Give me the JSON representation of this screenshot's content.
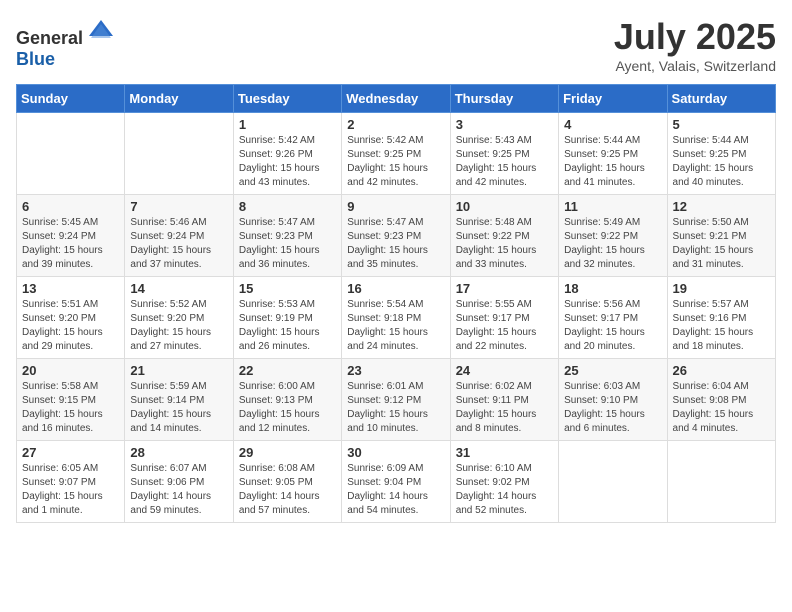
{
  "header": {
    "logo_general": "General",
    "logo_blue": "Blue",
    "title": "July 2025",
    "subtitle": "Ayent, Valais, Switzerland"
  },
  "calendar": {
    "days_of_week": [
      "Sunday",
      "Monday",
      "Tuesday",
      "Wednesday",
      "Thursday",
      "Friday",
      "Saturday"
    ],
    "weeks": [
      [
        {
          "day": null,
          "info": null
        },
        {
          "day": null,
          "info": null
        },
        {
          "day": "1",
          "info": "Sunrise: 5:42 AM\nSunset: 9:26 PM\nDaylight: 15 hours and 43 minutes."
        },
        {
          "day": "2",
          "info": "Sunrise: 5:42 AM\nSunset: 9:25 PM\nDaylight: 15 hours and 42 minutes."
        },
        {
          "day": "3",
          "info": "Sunrise: 5:43 AM\nSunset: 9:25 PM\nDaylight: 15 hours and 42 minutes."
        },
        {
          "day": "4",
          "info": "Sunrise: 5:44 AM\nSunset: 9:25 PM\nDaylight: 15 hours and 41 minutes."
        },
        {
          "day": "5",
          "info": "Sunrise: 5:44 AM\nSunset: 9:25 PM\nDaylight: 15 hours and 40 minutes."
        }
      ],
      [
        {
          "day": "6",
          "info": "Sunrise: 5:45 AM\nSunset: 9:24 PM\nDaylight: 15 hours and 39 minutes."
        },
        {
          "day": "7",
          "info": "Sunrise: 5:46 AM\nSunset: 9:24 PM\nDaylight: 15 hours and 37 minutes."
        },
        {
          "day": "8",
          "info": "Sunrise: 5:47 AM\nSunset: 9:23 PM\nDaylight: 15 hours and 36 minutes."
        },
        {
          "day": "9",
          "info": "Sunrise: 5:47 AM\nSunset: 9:23 PM\nDaylight: 15 hours and 35 minutes."
        },
        {
          "day": "10",
          "info": "Sunrise: 5:48 AM\nSunset: 9:22 PM\nDaylight: 15 hours and 33 minutes."
        },
        {
          "day": "11",
          "info": "Sunrise: 5:49 AM\nSunset: 9:22 PM\nDaylight: 15 hours and 32 minutes."
        },
        {
          "day": "12",
          "info": "Sunrise: 5:50 AM\nSunset: 9:21 PM\nDaylight: 15 hours and 31 minutes."
        }
      ],
      [
        {
          "day": "13",
          "info": "Sunrise: 5:51 AM\nSunset: 9:20 PM\nDaylight: 15 hours and 29 minutes."
        },
        {
          "day": "14",
          "info": "Sunrise: 5:52 AM\nSunset: 9:20 PM\nDaylight: 15 hours and 27 minutes."
        },
        {
          "day": "15",
          "info": "Sunrise: 5:53 AM\nSunset: 9:19 PM\nDaylight: 15 hours and 26 minutes."
        },
        {
          "day": "16",
          "info": "Sunrise: 5:54 AM\nSunset: 9:18 PM\nDaylight: 15 hours and 24 minutes."
        },
        {
          "day": "17",
          "info": "Sunrise: 5:55 AM\nSunset: 9:17 PM\nDaylight: 15 hours and 22 minutes."
        },
        {
          "day": "18",
          "info": "Sunrise: 5:56 AM\nSunset: 9:17 PM\nDaylight: 15 hours and 20 minutes."
        },
        {
          "day": "19",
          "info": "Sunrise: 5:57 AM\nSunset: 9:16 PM\nDaylight: 15 hours and 18 minutes."
        }
      ],
      [
        {
          "day": "20",
          "info": "Sunrise: 5:58 AM\nSunset: 9:15 PM\nDaylight: 15 hours and 16 minutes."
        },
        {
          "day": "21",
          "info": "Sunrise: 5:59 AM\nSunset: 9:14 PM\nDaylight: 15 hours and 14 minutes."
        },
        {
          "day": "22",
          "info": "Sunrise: 6:00 AM\nSunset: 9:13 PM\nDaylight: 15 hours and 12 minutes."
        },
        {
          "day": "23",
          "info": "Sunrise: 6:01 AM\nSunset: 9:12 PM\nDaylight: 15 hours and 10 minutes."
        },
        {
          "day": "24",
          "info": "Sunrise: 6:02 AM\nSunset: 9:11 PM\nDaylight: 15 hours and 8 minutes."
        },
        {
          "day": "25",
          "info": "Sunrise: 6:03 AM\nSunset: 9:10 PM\nDaylight: 15 hours and 6 minutes."
        },
        {
          "day": "26",
          "info": "Sunrise: 6:04 AM\nSunset: 9:08 PM\nDaylight: 15 hours and 4 minutes."
        }
      ],
      [
        {
          "day": "27",
          "info": "Sunrise: 6:05 AM\nSunset: 9:07 PM\nDaylight: 15 hours and 1 minute."
        },
        {
          "day": "28",
          "info": "Sunrise: 6:07 AM\nSunset: 9:06 PM\nDaylight: 14 hours and 59 minutes."
        },
        {
          "day": "29",
          "info": "Sunrise: 6:08 AM\nSunset: 9:05 PM\nDaylight: 14 hours and 57 minutes."
        },
        {
          "day": "30",
          "info": "Sunrise: 6:09 AM\nSunset: 9:04 PM\nDaylight: 14 hours and 54 minutes."
        },
        {
          "day": "31",
          "info": "Sunrise: 6:10 AM\nSunset: 9:02 PM\nDaylight: 14 hours and 52 minutes."
        },
        {
          "day": null,
          "info": null
        },
        {
          "day": null,
          "info": null
        }
      ]
    ]
  }
}
